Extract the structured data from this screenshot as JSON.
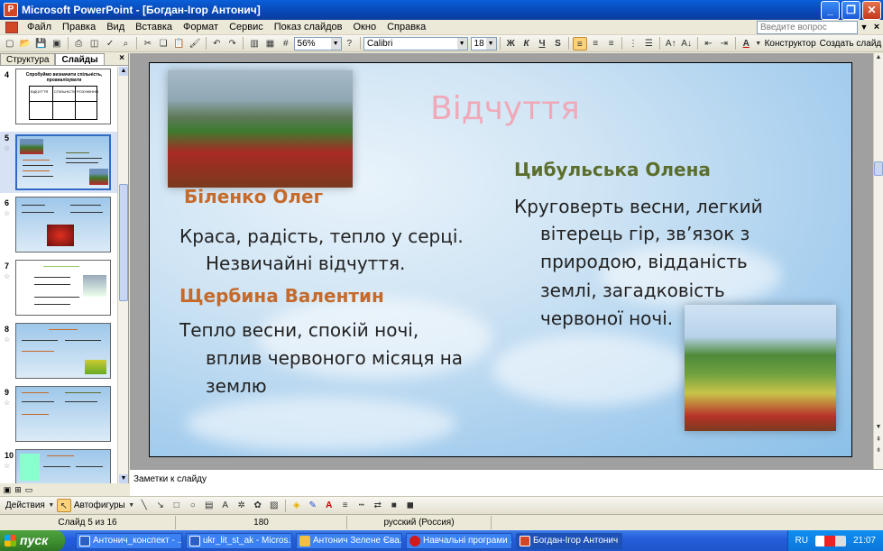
{
  "window": {
    "title": "Microsoft PowerPoint - [Богдан-Ігор Антонич]"
  },
  "menu": {
    "items": [
      "Файл",
      "Правка",
      "Вид",
      "Вставка",
      "Формат",
      "Сервис",
      "Показ слайдов",
      "Окно",
      "Справка"
    ],
    "help_placeholder": "Введите вопрос"
  },
  "toolbar": {
    "zoom": "56%",
    "font": "Calibri",
    "font_size": "18",
    "bold": "Ж",
    "italic": "К",
    "underline": "Ч",
    "shadow": "S",
    "designer": "Конструктор",
    "new_slide": "Создать слайд"
  },
  "leftpanel": {
    "tab_outline": "Структура",
    "tab_slides": "Слайды",
    "close": "×",
    "slide_numbers": [
      "4",
      "5",
      "6",
      "7",
      "8",
      "9",
      "10"
    ],
    "thumb4_title": "Спробуймо визначити спільність, проаналізувати",
    "thumb4_cols": [
      "ВІДЧУТТЯ",
      "СПІЛЬНІСТЬ",
      "РОЗУМІННЯ"
    ]
  },
  "slide": {
    "title": "Відчуття",
    "author1": "Біленко Олег",
    "text1_line1": "Краса, радість, тепло у серці.",
    "text1_line2": "Незвичайні відчуття.",
    "author2": "Щербина Валентин",
    "text2_line1": "Тепло весни, спокій ночі,",
    "text2_line2": "вплив червоного місяця на",
    "text2_line3": "землю",
    "author3": "Цибульська Олена",
    "text3_line1": "Круговерть весни, легкий",
    "text3_line2": "вітерець гір, зв’язок з",
    "text3_line3": "природою, відданість",
    "text3_line4": "землі, загадковість",
    "text3_line5": "червоної ночі."
  },
  "notes": {
    "placeholder": "Заметки к слайду"
  },
  "drawbar": {
    "actions": "Действия",
    "autoshapes": "Автофигуры"
  },
  "status": {
    "slide": "Слайд 5 из 16",
    "code": "180",
    "language": "русский (Россия)"
  },
  "taskbar": {
    "start": "пуск",
    "items": [
      "Антонич_конспект - ...",
      "ukr_lit_st_ak - Micros...",
      "Антонич Зелене Єва...",
      "Навчальні програми ...",
      "Богдан-Ігор Антонич"
    ],
    "lang": "RU",
    "clock": "21:07"
  },
  "colors": {
    "title_pink": "#f0a9b8",
    "author_orange": "#c56a2a",
    "author_green": "#5c6e2e",
    "xp_blue": "#245edb"
  }
}
